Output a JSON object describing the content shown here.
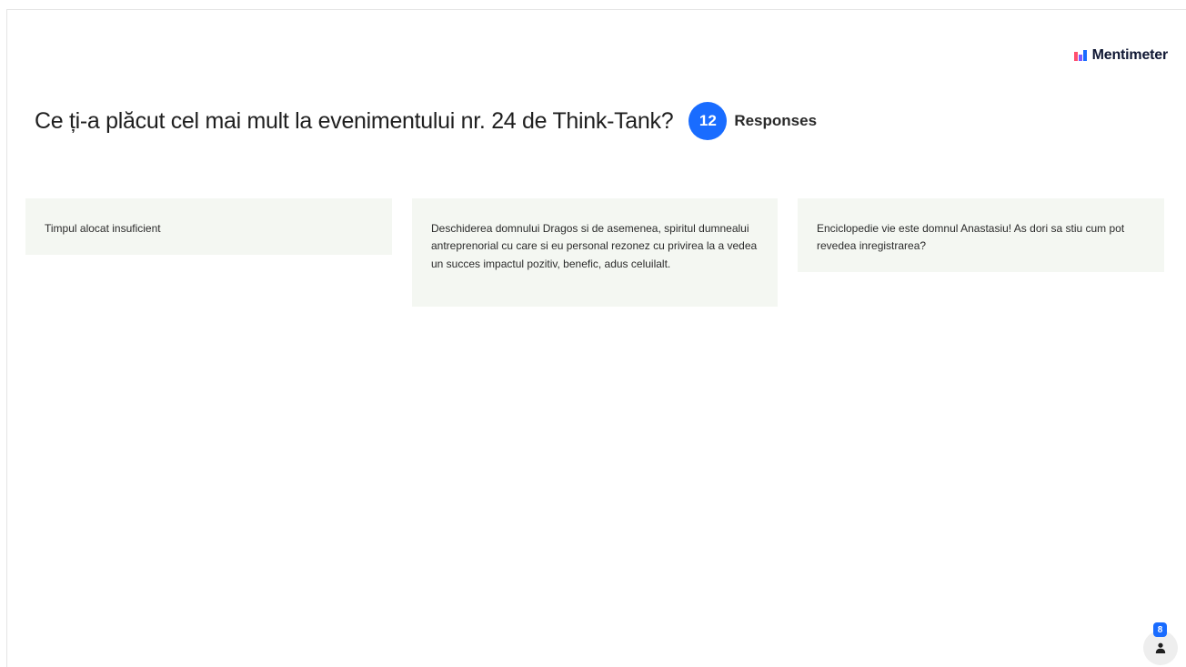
{
  "brand": {
    "name": "Mentimeter",
    "logo_icon": "mentimeter-logo-icon"
  },
  "question": {
    "text": "Ce ți-a plăcut cel mai mult la evenimentului nr. 24 de Think-Tank?",
    "response_count": "12",
    "response_label": "Responses"
  },
  "responses": [
    {
      "text": "Timpul alocat insuficient"
    },
    {
      "text": "Deschiderea domnului Dragos si de asemenea, spiritul dumnealui antreprenorial cu care si eu personal rezonez cu privirea la a vedea un succes impactul pozitiv, benefic, adus celuilalt."
    },
    {
      "text": "Enciclopedie vie este domnul Anastasiu! As dori sa stiu cum pot revedea inregistrarea?"
    }
  ],
  "audience": {
    "count": "8",
    "icon": "person-icon"
  },
  "colors": {
    "accent": "#196cff",
    "card_bg": "#f4f7f2",
    "text": "#1f1f1f"
  }
}
